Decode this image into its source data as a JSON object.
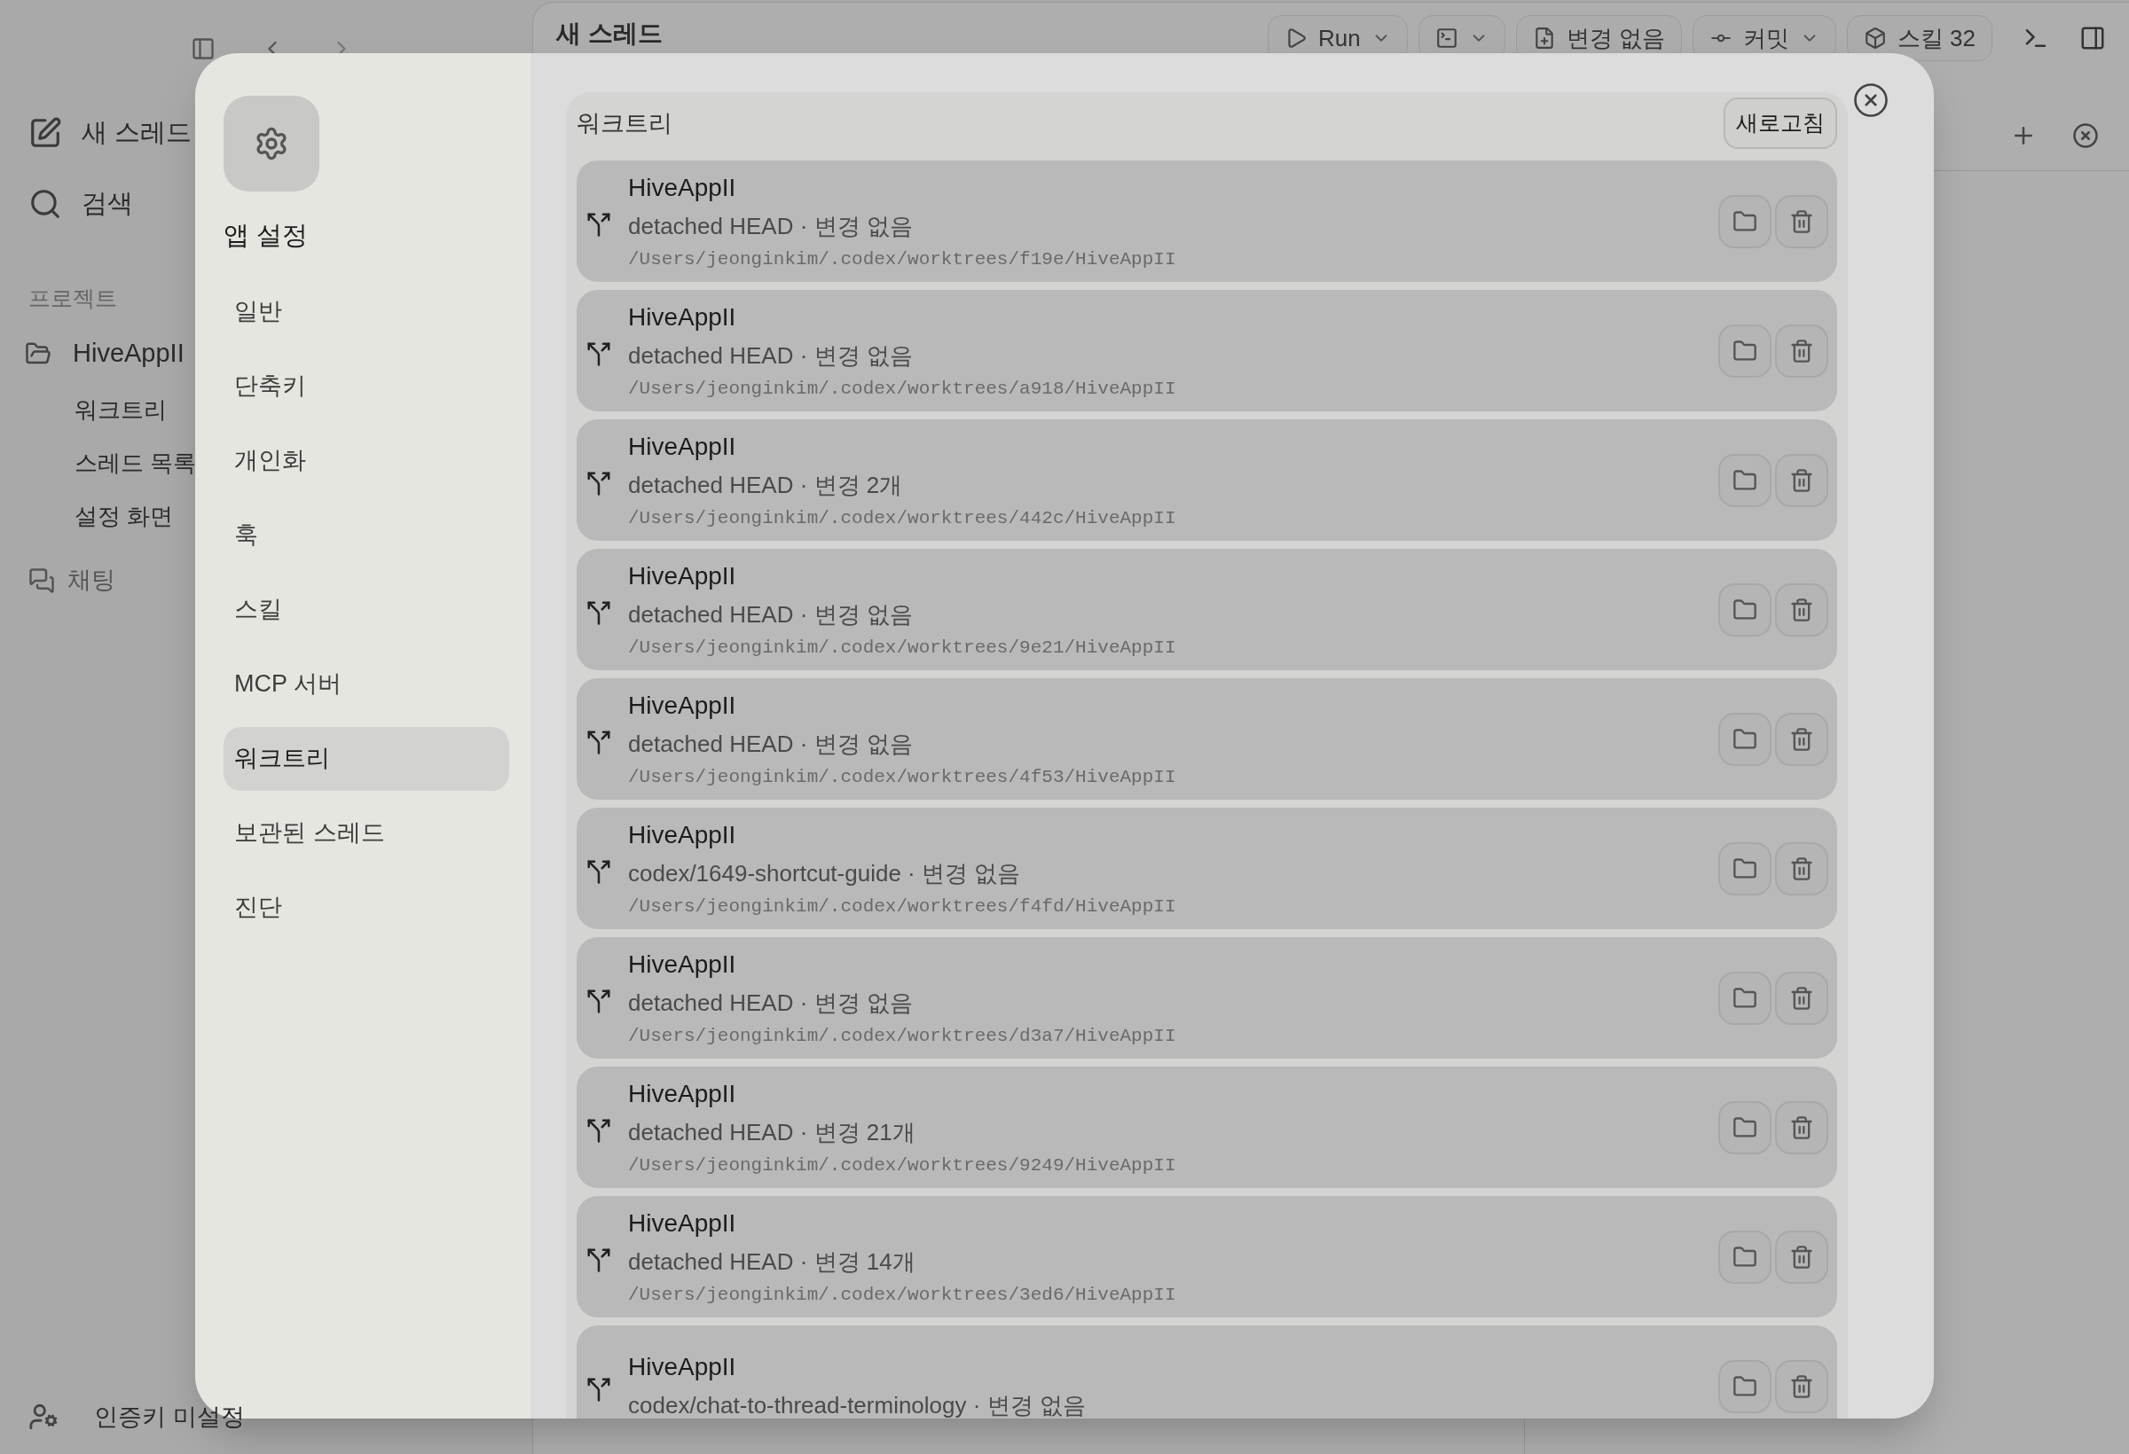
{
  "app": {
    "title": "새 스레드",
    "toolbar": [
      {
        "kind": "run",
        "label": "Run"
      },
      {
        "kind": "editor"
      },
      {
        "kind": "changes",
        "label": "변경 없음"
      },
      {
        "kind": "commit",
        "label": "커밋"
      },
      {
        "kind": "skills",
        "label": "스킬 32"
      }
    ]
  },
  "sidebar": {
    "actions": [
      {
        "kind": "new",
        "label": "새 스레드"
      },
      {
        "kind": "search",
        "label": "검색"
      }
    ],
    "section_label": "프로젝트",
    "project": {
      "name": "HiveAppII",
      "threads": [
        "워크트리",
        "스레드 목록",
        "설정 화면"
      ]
    },
    "chat": "채팅",
    "footer": "인증키 미설정"
  },
  "settings": {
    "title": "앱 설정",
    "nav": [
      {
        "label": "일반",
        "selected": false
      },
      {
        "label": "단축키",
        "selected": false
      },
      {
        "label": "개인화",
        "selected": false
      },
      {
        "label": "훅",
        "selected": false
      },
      {
        "label": "스킬",
        "selected": false
      },
      {
        "label": "MCP 서버",
        "selected": false
      },
      {
        "label": "워크트리",
        "selected": true
      },
      {
        "label": "보관된 스레드",
        "selected": false
      },
      {
        "label": "진단",
        "selected": false
      }
    ],
    "section": {
      "title": "워크트리",
      "refresh": "새로고침",
      "worktrees": [
        {
          "name": "HiveAppII",
          "detail": "detached HEAD · 변경 없음",
          "path": "/Users/jeonginkim/.codex/worktrees/f19e/HiveAppII"
        },
        {
          "name": "HiveAppII",
          "detail": "detached HEAD · 변경 없음",
          "path": "/Users/jeonginkim/.codex/worktrees/a918/HiveAppII"
        },
        {
          "name": "HiveAppII",
          "detail": "detached HEAD · 변경 2개",
          "path": "/Users/jeonginkim/.codex/worktrees/442c/HiveAppII"
        },
        {
          "name": "HiveAppII",
          "detail": "detached HEAD · 변경 없음",
          "path": "/Users/jeonginkim/.codex/worktrees/9e21/HiveAppII"
        },
        {
          "name": "HiveAppII",
          "detail": "detached HEAD · 변경 없음",
          "path": "/Users/jeonginkim/.codex/worktrees/4f53/HiveAppII"
        },
        {
          "name": "HiveAppII",
          "detail": "codex/1649-shortcut-guide · 변경 없음",
          "path": "/Users/jeonginkim/.codex/worktrees/f4fd/HiveAppII"
        },
        {
          "name": "HiveAppII",
          "detail": "detached HEAD · 변경 없음",
          "path": "/Users/jeonginkim/.codex/worktrees/d3a7/HiveAppII"
        },
        {
          "name": "HiveAppII",
          "detail": "detached HEAD · 변경 21개",
          "path": "/Users/jeonginkim/.codex/worktrees/9249/HiveAppII"
        },
        {
          "name": "HiveAppII",
          "detail": "detached HEAD · 변경 14개",
          "path": "/Users/jeonginkim/.codex/worktrees/3ed6/HiveAppII"
        },
        {
          "name": "HiveAppII",
          "detail": "codex/chat-to-thread-terminology · 변경 없음"
        }
      ]
    }
  }
}
